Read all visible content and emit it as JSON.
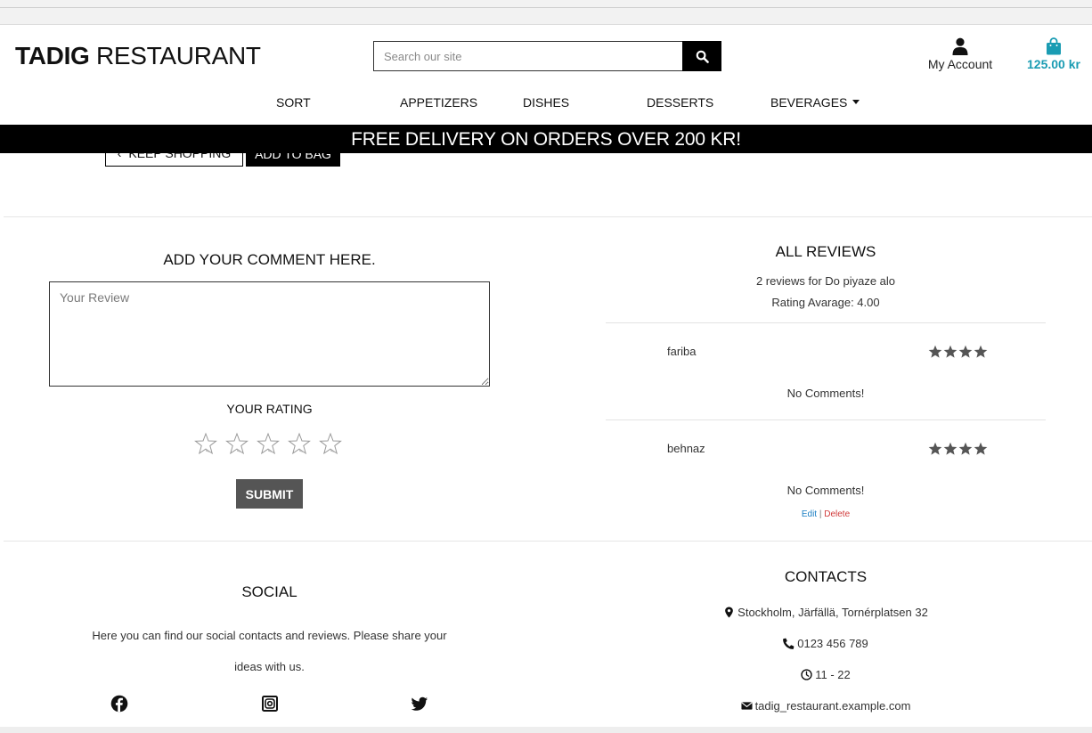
{
  "header": {
    "brand_bold": "TADIG",
    "brand_rest": " RESTAURANT",
    "search_placeholder": "Search our site",
    "account_label": "My Account",
    "cart_total": "125.00 kr",
    "accent_color": "#1a9cb3"
  },
  "nav": {
    "items": [
      {
        "label": "SORT"
      },
      {
        "label": "APPETIZERS"
      },
      {
        "label": "DISHES"
      },
      {
        "label": "DESSERTS"
      },
      {
        "label": "BEVERAGES"
      }
    ]
  },
  "banner": {
    "text": "FREE DELIVERY ON ORDERS OVER 200 KR!"
  },
  "product_actions": {
    "keep_shopping": "KEEP SHOPPING",
    "add_to_bag": "ADD TO BAG"
  },
  "comment_form": {
    "heading": "ADD YOUR COMMENT HERE.",
    "review_placeholder": "Your Review",
    "rating_heading": "YOUR RATING",
    "star_count": 5,
    "submit_label": "SUBMIT"
  },
  "reviews": {
    "heading": "ALL REVIEWS",
    "count_text": "2 reviews for Do piyaze alo",
    "average_text": "Rating Avarage: 4.00",
    "items": [
      {
        "user": "fariba",
        "rating": 4,
        "comment": "No Comments!"
      },
      {
        "user": "behnaz",
        "rating": 4,
        "comment": "No Comments!",
        "edit_label": "Edit",
        "separator": " | ",
        "delete_label": "Delete"
      }
    ]
  },
  "footer": {
    "social_heading": "SOCIAL",
    "social_text": "Here you can find our social contacts and reviews. Please share your ideas with us.",
    "social_icons": [
      "facebook-icon",
      "instagram-icon",
      "twitter-icon"
    ],
    "contacts_heading": "CONTACTS",
    "address": "Stockholm, Järfällä, Tornérplatsen 32",
    "phone": "0123 456 789",
    "hours": "11 - 22",
    "email": "tadig_restaurant.example.com"
  }
}
